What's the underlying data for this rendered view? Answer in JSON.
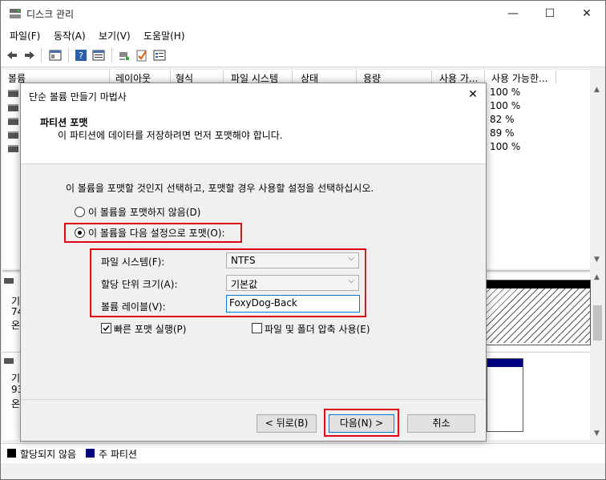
{
  "window": {
    "title": "디스크 관리",
    "minimize_glyph": "—",
    "maximize_glyph": "☐",
    "close_glyph": "✕"
  },
  "menu": [
    "파일(F)",
    "동작(A)",
    "보기(V)",
    "도움말(H)"
  ],
  "toolbar_icons": [
    "back-icon",
    "forward-icon",
    "console-icon",
    "help-icon",
    "properties-icon",
    "connect-icon",
    "check-icon",
    "list-icon"
  ],
  "columns": [
    "볼륨",
    "레이아웃",
    "형식",
    "파일 시스템",
    "상태",
    "용량",
    "사용 가...",
    "사용 가능한..."
  ],
  "volume_free_pct": [
    "100 %",
    "100 %",
    "82 %",
    "89 %",
    "100 %"
  ],
  "disk_area": {
    "disk1_type_initial": "기",
    "disk1_size_initial": "74",
    "disk1_status_initial": "온",
    "disk2_type_initial": "기",
    "disk2_size_initial": "93",
    "disk2_status_initial": "온"
  },
  "legend": {
    "unallocated": "할당되지 않음",
    "primary": "주 파티션",
    "unallocated_color": "#000000",
    "primary_color": "#000080"
  },
  "dialog": {
    "title": "단순 볼륨 만들기 마법사",
    "heading": "파티션 포맷",
    "subheading": "이 파티션에 데이터를 저장하려면 먼저 포맷해야 합니다.",
    "instruction": "이 볼륨을 포맷할 것인지 선택하고, 포맷할 경우 사용할 설정을 선택하십시오.",
    "radio_no_format": "이 볼륨을 포맷하지 않음(D)",
    "radio_format": "이 볼륨을 다음 설정으로 포맷(O):",
    "fs_label": "파일 시스템(F):",
    "fs_value": "NTFS",
    "alloc_label": "할당 단위 크기(A):",
    "alloc_value": "기본값",
    "vol_label": "볼륨 레이블(V):",
    "vol_value": "FoxyDog-Back",
    "quick_format": "빠른 포맷 실행(P)",
    "compress": "파일 및 폴더 압축 사용(E)",
    "back_button": "< 뒤로(B)",
    "next_button": "다음(N) >",
    "cancel_button": "취소"
  },
  "highlight_color": "#e0001a"
}
